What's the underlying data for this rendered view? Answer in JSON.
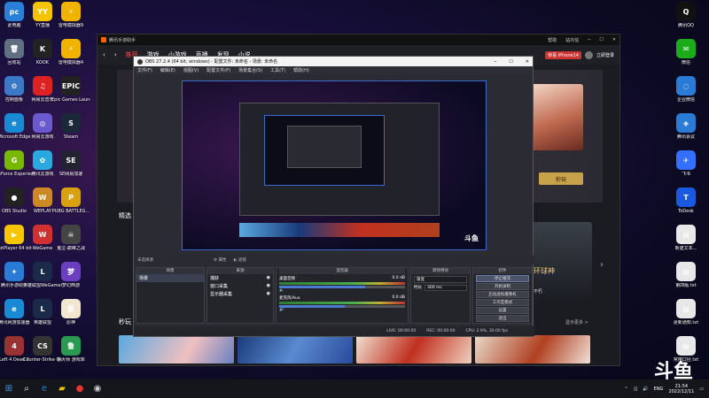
{
  "desktop_left": [
    {
      "label": "此电脑",
      "icon": "pc",
      "color": "#2a80d6"
    },
    {
      "label": "YY直播",
      "icon": "YY",
      "color": "#f5c400"
    },
    {
      "label": "雷电模拟器9",
      "icon": "⚡",
      "color": "#f0b400"
    },
    {
      "label": "回收站",
      "icon": "🗑",
      "color": "#607080"
    },
    {
      "label": "KOOK",
      "icon": "K",
      "color": "#222"
    },
    {
      "label": "雷电模拟器4",
      "icon": "⚡",
      "color": "#f0b400"
    },
    {
      "label": "控制面板",
      "icon": "⚙",
      "color": "#3a78c8"
    },
    {
      "label": "网易云音乐",
      "icon": "♫",
      "color": "#d22"
    },
    {
      "label": "Epic Games Launcher",
      "icon": "EPIC",
      "color": "#222"
    },
    {
      "label": "Microsoft Edge",
      "icon": "e",
      "color": "#1a8ad4"
    },
    {
      "label": "网易云游戏",
      "icon": "◎",
      "color": "#6a5acd"
    },
    {
      "label": "Steam",
      "icon": "S",
      "color": "#1b2838"
    },
    {
      "label": "GeForce Experience",
      "icon": "G",
      "color": "#76b900"
    },
    {
      "label": "腾讯云游戏",
      "icon": "✿",
      "color": "#2aa8e0"
    },
    {
      "label": "SE网易加速",
      "icon": "SE",
      "color": "#223"
    },
    {
      "label": "OBS Studio",
      "icon": "●",
      "color": "#222"
    },
    {
      "label": "WEPLAY",
      "icon": "W",
      "color": "#c82"
    },
    {
      "label": "PUBG BATTLEG...",
      "icon": "P",
      "color": "#d9a010"
    },
    {
      "label": "PotPlayer 64 bit",
      "icon": "▶",
      "color": "#f7c600"
    },
    {
      "label": "WeGame",
      "icon": "W",
      "color": "#d03030"
    },
    {
      "label": "鬼泣-巅峰之战",
      "icon": "☠",
      "color": "#444"
    },
    {
      "label": "腾讯手游助手",
      "icon": "✦",
      "color": "#2a7bd6"
    },
    {
      "label": "英雄联盟WeGame版",
      "icon": "L",
      "color": "#1a2a48"
    },
    {
      "label": "梦幻西游",
      "icon": "梦",
      "color": "#6a40c0"
    },
    {
      "label": "腾讯网游加速器",
      "icon": "e",
      "color": "#1a8ad4"
    },
    {
      "label": "英雄联盟",
      "icon": "L",
      "color": "#1a2a48"
    },
    {
      "label": "原神",
      "icon": "原",
      "color": "#f2e6d0"
    },
    {
      "label": "Left 4 Dead 2",
      "icon": "4",
      "color": "#933"
    },
    {
      "label": "Counter-Strike Global Off...",
      "icon": "CS",
      "color": "#333"
    },
    {
      "label": "鲁大师 游戏库",
      "icon": "鲁",
      "color": "#2a9a50"
    }
  ],
  "desktop_right": [
    {
      "label": "腾讯QQ",
      "icon": "Q",
      "color": "#111"
    },
    {
      "label": "微信",
      "icon": "✉",
      "color": "#1aad19"
    },
    {
      "label": "企业微信",
      "icon": "◌",
      "color": "#2a7bd6"
    },
    {
      "label": "腾讯会议",
      "icon": "◈",
      "color": "#2a7bd6"
    },
    {
      "label": "飞书",
      "icon": "✈",
      "color": "#3370ff"
    },
    {
      "label": "ToDesk",
      "icon": "T",
      "color": "#1a5ae0"
    },
    {
      "label": "新建文本...",
      "icon": "▤",
      "color": "#e8e8e8"
    },
    {
      "label": "第四版.txt",
      "icon": "▤",
      "color": "#e8e8e8"
    },
    {
      "label": "更新通知.txt",
      "icon": "▤",
      "color": "#e8e8e8"
    },
    {
      "label": "常用口径.txt",
      "icon": "▤",
      "color": "#e8e8e8"
    }
  ],
  "browser": {
    "title": "腾讯手游助手",
    "nav": [
      "推荐",
      "游戏",
      "小游戏",
      "直播",
      "发现",
      "小说"
    ],
    "buttons": {
      "help": "帮助",
      "recharge": "站内信",
      "login": "立即登录"
    },
    "banner_text": "恭喜 iPhone14",
    "play_button": "秒玩",
    "section_title": "精选",
    "section2_title": "秒玩",
    "more": "更多 >",
    "right_game": "环球神",
    "right_game2": "不朽",
    "bottom_strip": "显示更多 >"
  },
  "obs": {
    "title": "OBS 27.2.4 (64 bit, windows) - 配置文件: 未命名 - 场景: 未命名",
    "menu": [
      "文件(F)",
      "编辑(E)",
      "视图(V)",
      "配置文件(P)",
      "场景集合(S)",
      "工具(T)",
      "帮助(H)"
    ],
    "scene_header": "场景",
    "scenes": [
      "场景"
    ],
    "sources_header": "来源",
    "sources": [
      "捕获",
      "窗口采集",
      "显示器采集"
    ],
    "mixer_header": "混音器",
    "mixer": [
      {
        "name": "桌面音频",
        "db": "0.0 dB",
        "level": 0.68
      },
      {
        "name": "麦克风/Aux",
        "db": "0.0 dB",
        "level": 0.52
      }
    ],
    "transition_header": "转场特效",
    "transition_type": "渐变",
    "duration_label": "时长",
    "duration": "300 ms",
    "controls_header": "控件",
    "controls": [
      "停止推流",
      "开始录制",
      "启动虚拟摄像机",
      "工作室模式",
      "设置",
      "退出"
    ],
    "status": {
      "live": "LIVE: 00:00:00",
      "rec": "REC: 00:00:00",
      "cpu": "CPU: 2.9%, 30.00 fps"
    },
    "no_source_label": "未选择源",
    "tabs": [
      "属性",
      "滤镜"
    ]
  },
  "taskbar": {
    "lang": "ENG",
    "time": "21:54",
    "date": "2022/12/11"
  },
  "watermark": "斗鱼"
}
